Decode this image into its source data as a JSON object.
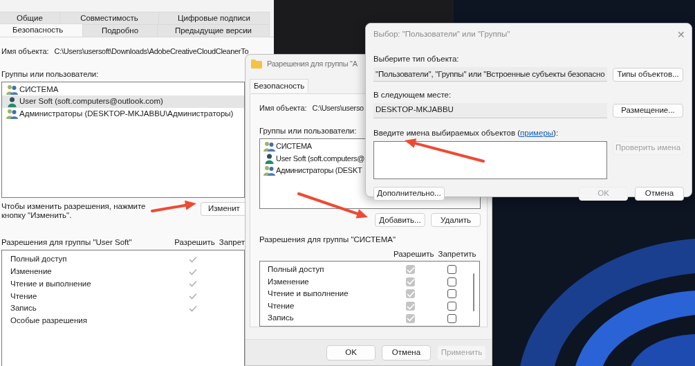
{
  "properties_window": {
    "tab_rows": [
      [
        {
          "label": "Общие",
          "selected": false
        },
        {
          "label": "Совместимость",
          "selected": false
        },
        {
          "label": "Цифровые подписи",
          "selected": false
        }
      ],
      [
        {
          "label": "Безопасность",
          "selected": true
        },
        {
          "label": "Подробно",
          "selected": false
        },
        {
          "label": "Предыдущие версии",
          "selected": false
        }
      ]
    ],
    "object_label": "Имя объекта:",
    "object_path": "C:\\Users\\usersoft\\Downloads\\AdobeCreativeCloudCleanerTo",
    "groups_label": "Группы или пользователи:",
    "groups": [
      {
        "kind": "group",
        "name": "СИСТЕМА",
        "selected": false
      },
      {
        "kind": "user",
        "name": "User Soft (soft.computers@outlook.com)",
        "selected": true
      },
      {
        "kind": "group",
        "name": "Администраторы (DESKTOP-MKJABBU\\Администраторы)",
        "selected": false
      }
    ],
    "hint": "Чтобы изменить разрешения, нажмите кнопку \"Изменить\".",
    "edit_button": "Изменит",
    "permissions_title": "Разрешения для группы \"User Soft\"",
    "columns": [
      "Разрешить",
      "Запрет"
    ],
    "permissions": [
      {
        "name": "Полный доступ",
        "allow": true
      },
      {
        "name": "Изменение",
        "allow": true
      },
      {
        "name": "Чтение и выполнение",
        "allow": true
      },
      {
        "name": "Чтение",
        "allow": true
      },
      {
        "name": "Запись",
        "allow": true
      },
      {
        "name": "Особые разрешения",
        "allow": false
      }
    ]
  },
  "permissions_window": {
    "title": "Разрешения для группы \"А",
    "tab": {
      "label": "Безопасность",
      "selected": true
    },
    "object_label": "Имя объекта:",
    "object_path": "C:\\Users\\userso",
    "groups_label": "Группы или пользователи:",
    "groups": [
      {
        "kind": "group",
        "name": "СИСТЕМА",
        "selected": false
      },
      {
        "kind": "user",
        "name": "User Soft (soft.computers@",
        "selected": false
      },
      {
        "kind": "group",
        "name": "Администраторы (DESKT",
        "selected": false
      }
    ],
    "add_button": "Добавить...",
    "remove_button": "Удалить",
    "permissions_title": "Разрешения для группы \"СИСТЕМА\"",
    "columns": [
      "Разрешить",
      "Запретить"
    ],
    "permissions": [
      {
        "name": "Полный доступ",
        "allow": true,
        "deny": false
      },
      {
        "name": "Изменение",
        "allow": true,
        "deny": false
      },
      {
        "name": "Чтение и выполнение",
        "allow": true,
        "deny": false
      },
      {
        "name": "Чтение",
        "allow": true,
        "deny": false
      },
      {
        "name": "Запись",
        "allow": true,
        "deny": false
      }
    ],
    "buttons": [
      {
        "label": "OK",
        "disabled": false
      },
      {
        "label": "Отмена",
        "disabled": false
      },
      {
        "label": "Применить",
        "disabled": true
      }
    ]
  },
  "select_dialog": {
    "title": "Выбор: \"Пользователи\" или \"Группы\"",
    "close": "✕",
    "type_label": "Выберите тип объекта:",
    "type_value": "\"Пользователи\", \"Группы\" или \"Встроенные субъекты безопасно",
    "types_button": "Типы объектов...",
    "location_label": "В следующем месте:",
    "location_value": "DESKTOP-MKJABBU",
    "location_button": "Размещение...",
    "names_label": "Введите имена выбираемых объектов (",
    "names_link": "примеры",
    "names_label_end": "):",
    "check_button": {
      "label": "Проверить имена",
      "disabled": true
    },
    "advanced_button": "Дополнительно...",
    "buttons": [
      {
        "label": "OK",
        "disabled": true
      },
      {
        "label": "Отмена",
        "disabled": false
      }
    ]
  }
}
